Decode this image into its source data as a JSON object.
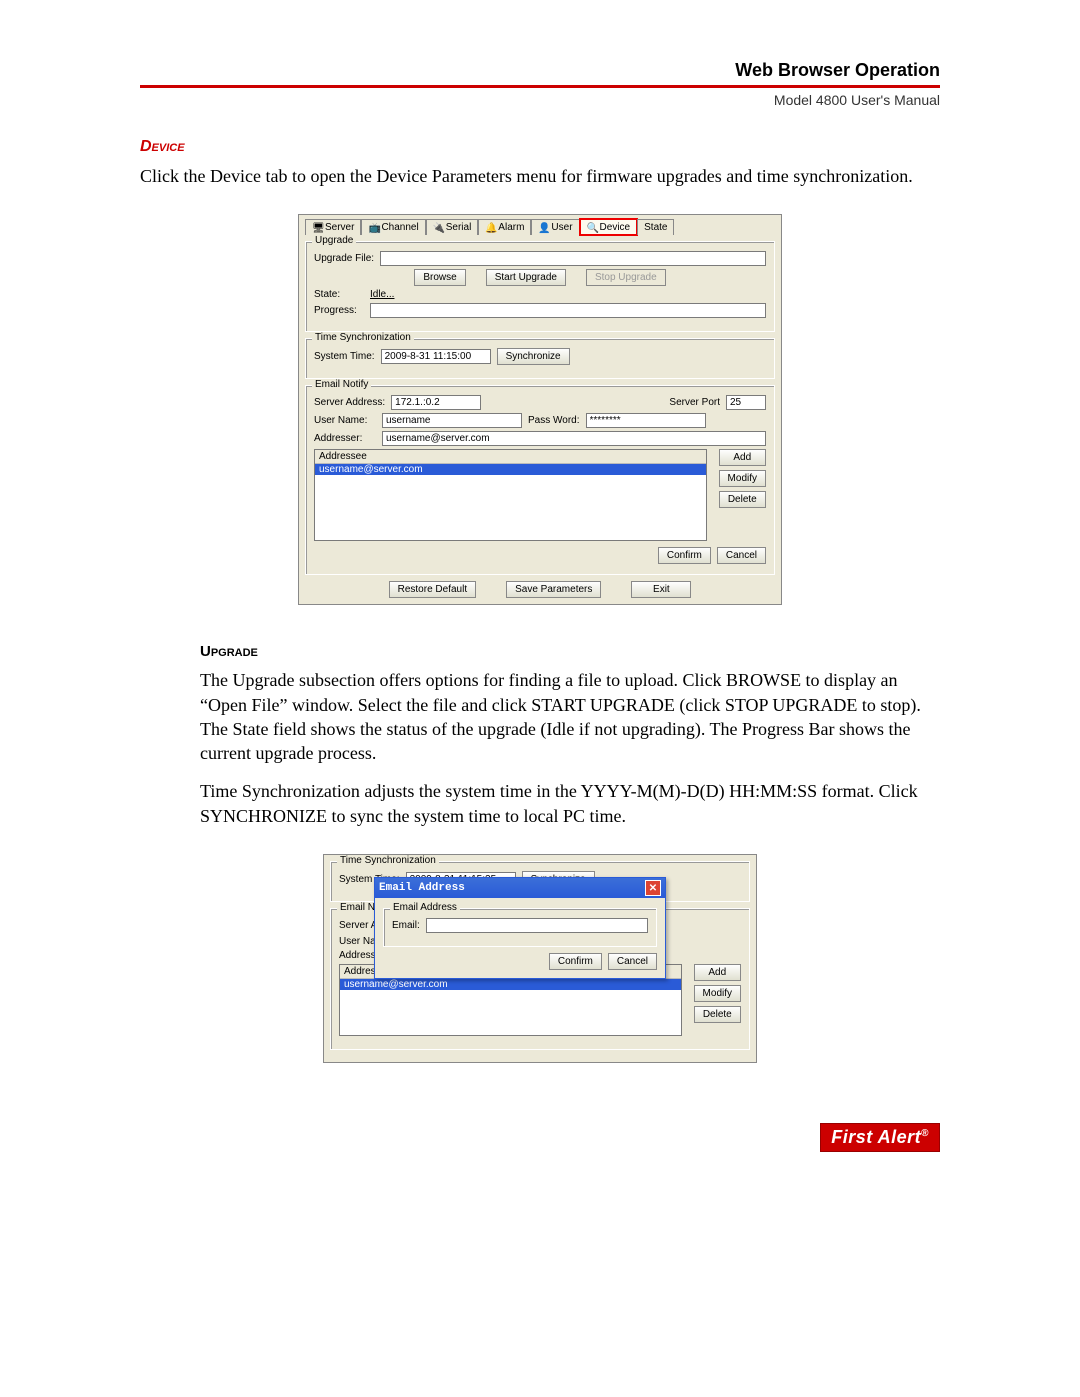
{
  "header": {
    "title": "Web Browser Operation",
    "subtitle": "Model 4800 User's Manual"
  },
  "section": {
    "device_label": "Device",
    "device_intro": "Click the Device tab to open the Device Parameters menu for firmware upgrades and time synchronization.",
    "upgrade_label": "Upgrade",
    "upgrade_p1": "The Upgrade subsection offers options for finding a file to upload. Click BROWSE to display an “Open File” window. Select the file and click START UPGRADE (click STOP UPGRADE to stop). The State field shows the status of the upgrade (Idle if not upgrading). The Progress Bar shows the current upgrade process.",
    "upgrade_p2": "Time Synchronization adjusts the system time in the YYYY-M(M)-D(D) HH:MM:SS format. Click SYNCHRONIZE to sync the system time to local PC time."
  },
  "shot1": {
    "tabs": {
      "server": "Server",
      "channel": "Channel",
      "serial": "Serial",
      "alarm": "Alarm",
      "user": "User",
      "device": "Device",
      "state": "State"
    },
    "upgrade": {
      "group": "Upgrade",
      "file_label": "Upgrade File:",
      "file_value": "",
      "browse": "Browse",
      "start": "Start Upgrade",
      "stop": "Stop Upgrade",
      "state_label": "State:",
      "state_value": "Idle...",
      "progress_label": "Progress:"
    },
    "timesync": {
      "group": "Time Synchronization",
      "systime_label": "System Time:",
      "systime_value": "2009-8-31 11:15:00",
      "sync_btn": "Synchronize"
    },
    "email": {
      "group": "Email Notify",
      "server_addr_label": "Server Address:",
      "server_addr_value": "172.1.:0.2",
      "server_port_label": "Server Port",
      "server_port_value": "25",
      "user_label": "User Name:",
      "user_value": "username",
      "pass_label": "Pass Word:",
      "pass_value": "********",
      "addresser_label": "Addresser:",
      "addresser_value": "username@server.com",
      "list_header": "Addressee",
      "list_item": "username@server.com",
      "add": "Add",
      "modify": "Modify",
      "delete": "Delete",
      "confirm": "Confirm",
      "cancel": "Cancel"
    },
    "footer": {
      "restore": "Restore Default",
      "save": "Save Parameters",
      "exit": "Exit"
    }
  },
  "shot2": {
    "timesync": {
      "group": "Time Synchronization",
      "systime_label": "System Time:",
      "systime_value": "2009-8-31 11:15:25",
      "sync_btn": "Synchronize"
    },
    "email": {
      "group": "Email Notify",
      "server_label_trunc": "Server Ad",
      "user_label_trunc": "User Nam",
      "addresser_label_trunc": "Addresse",
      "list_header": "Addressee",
      "list_item": "username@server.com",
      "add": "Add",
      "modify": "Modify",
      "delete": "Delete"
    },
    "dialog": {
      "title": "Email Address",
      "field_group": "Email Address",
      "email_label": "Email:",
      "email_value": "",
      "confirm": "Confirm",
      "cancel": "Cancel"
    }
  },
  "logo": {
    "text": "First Alert",
    "reg": "®"
  }
}
